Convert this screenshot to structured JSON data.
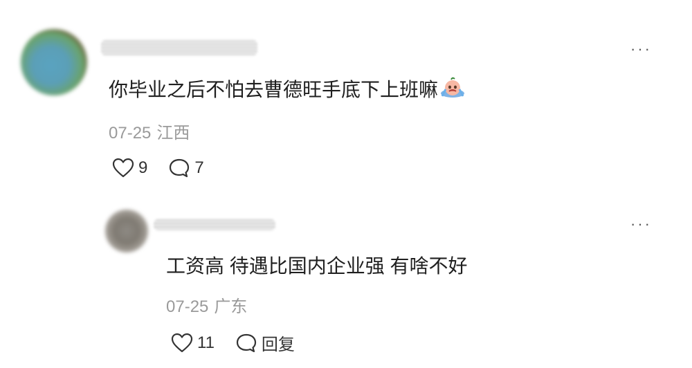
{
  "comments": [
    {
      "text": "你毕业之后不怕去曹德旺手底下上班嘛",
      "emoji": "crying-face-emoji",
      "date": "07-25",
      "location": "江西",
      "likes": "9",
      "replies": "7",
      "more": "···"
    },
    {
      "text": "工资高 待遇比国内企业强 有啥不好",
      "date": "07-25",
      "location": "广东",
      "likes": "11",
      "reply_label": "回复",
      "more": "···"
    }
  ]
}
